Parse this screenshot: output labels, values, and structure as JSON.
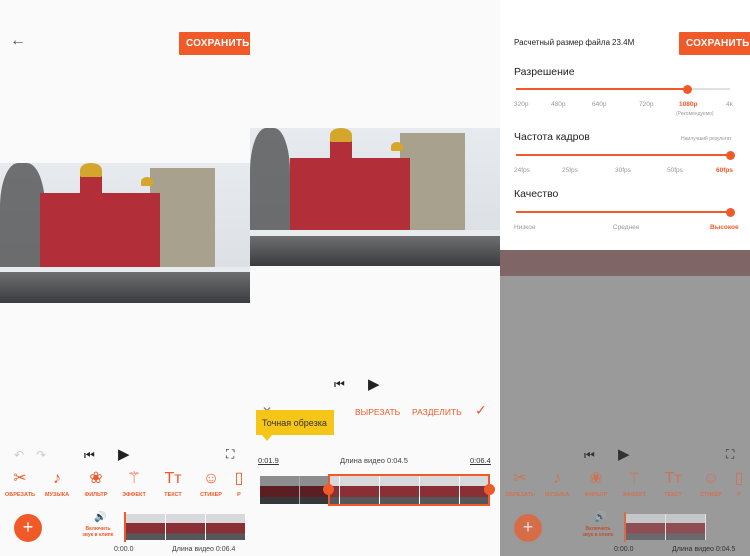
{
  "panel1": {
    "save_label": "СОХРАНИТЬ",
    "toolbar": [
      "ОБРЕЗАТЬ",
      "МУЗЫКА",
      "ФИЛЬТР",
      "ЭФФЕКТ",
      "ТЕКСТ",
      "СТИКЕР",
      "Р"
    ],
    "mute_label": "Включить звук в клипе",
    "time_current": "0:00.0",
    "duration": "Длина видео 0:06.4"
  },
  "panel2": {
    "cut_label": "ВЫРЕЗАТЬ",
    "split_label": "РАЗДЕЛИТЬ",
    "tooltip": "Точная обрезка",
    "start_time": "0:01.9",
    "length": "Длина видео 0:04.5",
    "end_time": "0:06.4"
  },
  "panel3": {
    "file_size_label": "Расчетный размер файла",
    "file_size_value": "23.4M",
    "save_label": "СОХРАНИТЬ",
    "resolution": {
      "title": "Разрешение",
      "ticks": [
        "320p",
        "480p",
        "640p",
        "720p",
        "1080p",
        "4k"
      ],
      "selected": "1080p",
      "note": "(Рекомендуемо)",
      "level": 0.8
    },
    "framerate": {
      "title": "Частота кадров",
      "hint": "Наилучший результат",
      "ticks": [
        "24fps",
        "25fps",
        "30fps",
        "50fps",
        "60fps"
      ],
      "selected": "60fps",
      "level": 1.0
    },
    "quality": {
      "title": "Качество",
      "ticks": [
        "Низкое",
        "Среднее",
        "Высокое"
      ],
      "selected": "Высокое",
      "level": 1.0
    },
    "toolbar": [
      "ОБРЕЗАТЬ",
      "МУЗЫКА",
      "ФИЛЬТР",
      "ЭФФЕКТ",
      "ТЕКСТ",
      "СТИКЕР",
      "Р"
    ],
    "mute_label": "Включить звук в клипе",
    "time_current": "0:00.0",
    "duration": "Длина видео 0:04.5"
  },
  "colors": {
    "accent": "#f05a28",
    "tooltip": "#f5c518"
  }
}
